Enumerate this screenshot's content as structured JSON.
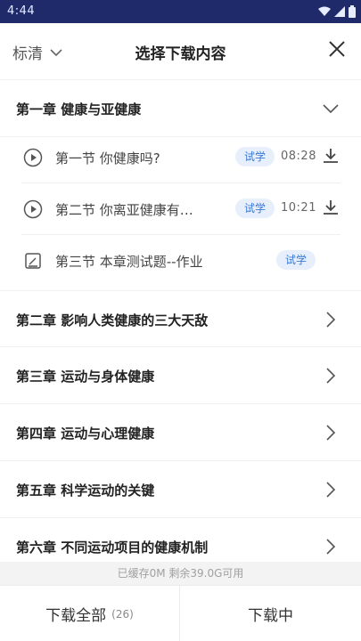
{
  "status_bar": {
    "time": "4:44",
    "icons": [
      "wifi-icon",
      "signal-icon",
      "battery-icon"
    ]
  },
  "header": {
    "quality": "标清",
    "title": "选择下载内容"
  },
  "chapters": [
    {
      "label": "第一章  健康与亚健康",
      "expanded": true,
      "sections": [
        {
          "label": "第一节  你健康吗?",
          "badge": "试学",
          "duration": "08:28",
          "icon": "play-circle-icon",
          "downloadable": true
        },
        {
          "label": "第二节  你离亚健康有…",
          "badge": "试学",
          "duration": "10:21",
          "icon": "play-circle-icon",
          "downloadable": true
        },
        {
          "label": "第三节  本章测试题--作业",
          "badge": "试学",
          "icon": "document-edit-icon",
          "downloadable": false
        }
      ]
    },
    {
      "label": "第二章  影响人类健康的三大天敌",
      "expanded": false
    },
    {
      "label": "第三章  运动与身体健康",
      "expanded": false
    },
    {
      "label": "第四章  运动与心理健康",
      "expanded": false
    },
    {
      "label": "第五章  科学运动的关键",
      "expanded": false
    },
    {
      "label": "第六章  不同运动项目的健康机制",
      "expanded": false
    }
  ],
  "storage": {
    "text": "已缓存0M    剩余39.0G可用"
  },
  "footer": {
    "download_all": "下载全部",
    "count": "(26)",
    "downloading": "下载中"
  },
  "colors": {
    "status_bar": "#1f2a6b",
    "badge_bg": "#e6effb",
    "badge_text": "#3a78d6"
  }
}
